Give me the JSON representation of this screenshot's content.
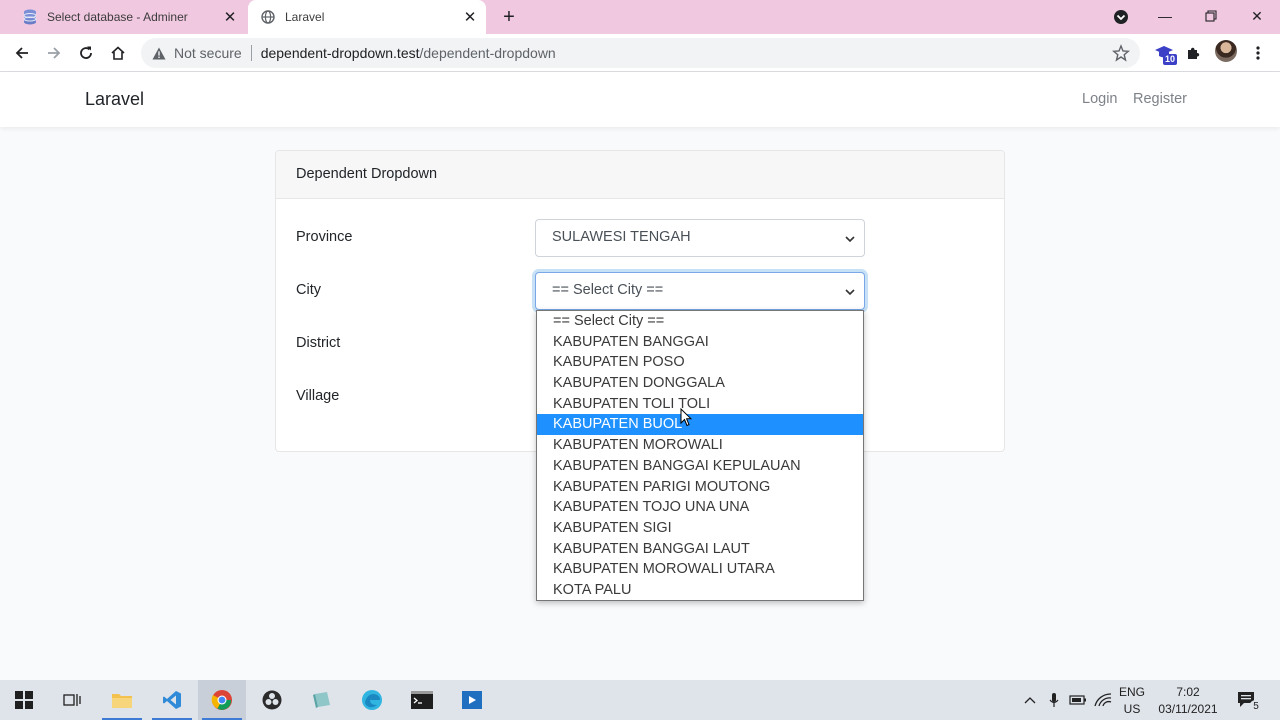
{
  "browser": {
    "tabs": [
      {
        "title": "Select database - Adminer",
        "icon": "database-icon",
        "active": false
      },
      {
        "title": "Laravel",
        "icon": "globe-icon",
        "active": true
      }
    ],
    "address": {
      "security_label": "Not secure",
      "host": "dependent-dropdown.test",
      "path": "/dependent-dropdown"
    },
    "extension_badge": "10"
  },
  "app": {
    "brand": "Laravel",
    "nav": {
      "login": "Login",
      "register": "Register"
    },
    "card_title": "Dependent Dropdown",
    "form": {
      "province_label": "Province",
      "province_value": "SULAWESI TENGAH",
      "city_label": "City",
      "city_value": "== Select City ==",
      "district_label": "District",
      "village_label": "Village"
    },
    "city_options": [
      "== Select City ==",
      "KABUPATEN BANGGAI",
      "KABUPATEN POSO",
      "KABUPATEN DONGGALA",
      "KABUPATEN TOLI TOLI",
      "KABUPATEN BUOL",
      "KABUPATEN MOROWALI",
      "KABUPATEN BANGGAI KEPULAUAN",
      "KABUPATEN PARIGI MOUTONG",
      "KABUPATEN TOJO UNA UNA",
      "KABUPATEN SIGI",
      "KABUPATEN BANGGAI LAUT",
      "KABUPATEN MOROWALI UTARA",
      "KOTA PALU"
    ],
    "highlighted_option": "KABUPATEN BUOL"
  },
  "taskbar": {
    "apps": [
      "file-explorer-icon",
      "vscode-icon",
      "chrome-icon",
      "obs-icon",
      "notes-icon",
      "edge-icon",
      "terminal-icon",
      "media-icon"
    ],
    "language": "ENG",
    "region": "US",
    "time": "7:02",
    "date": "03/11/2021",
    "notification_count": "5"
  },
  "colors": {
    "tabstrip": "#f0c8e0",
    "highlight": "#1e90ff",
    "page_bg": "#f8fafc"
  }
}
